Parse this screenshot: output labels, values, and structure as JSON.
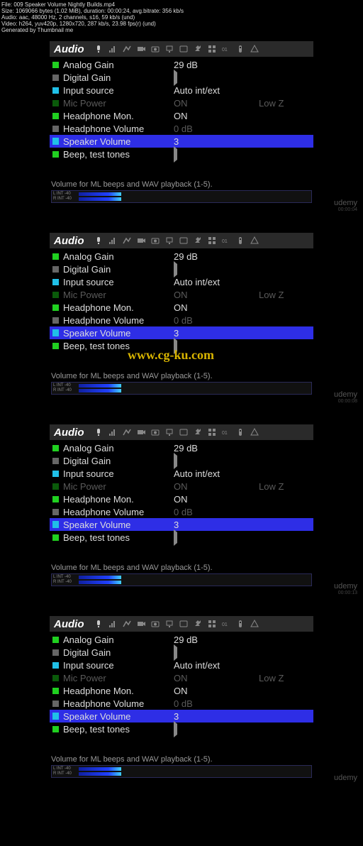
{
  "meta": {
    "line1": "File: 009 Speaker Volume Nightly Builds.mp4",
    "line2": "Size: 1069066 bytes (1.02 MiB), duration: 00:00:24, avg.bitrate: 356 kb/s",
    "line3": "Audio: aac, 48000 Hz, 2 channels, s16, 59 kb/s (und)",
    "line4": "Video: h264, yuv420p, 1280x720, 287 kb/s, 23.98 fps(r) (und)",
    "line5": "Generated by Thumbnail me"
  },
  "panel": {
    "title": "Audio",
    "items": [
      {
        "bullet": "b-green",
        "label": "Analog Gain",
        "value": "29 dB"
      },
      {
        "bullet": "b-gray",
        "label": "Digital Gain",
        "value": "",
        "tri": true
      },
      {
        "bullet": "b-cyan",
        "label": "Input source",
        "value": "Auto int/ext"
      },
      {
        "bullet": "b-darkgreen",
        "label": "Mic Power",
        "value": "ON",
        "dim": true,
        "extra": "Low Z"
      },
      {
        "bullet": "b-green",
        "label": "Headphone Mon.",
        "value": "ON"
      },
      {
        "bullet": "b-gray",
        "label": "Headphone Volume",
        "value": "0 dB",
        "vdim": true
      },
      {
        "bullet": "b-cyanbox",
        "label": "Speaker Volume",
        "value": "3",
        "sel": true
      },
      {
        "bullet": "b-green",
        "label": "Beep, test tones",
        "value": "",
        "tri": true
      }
    ],
    "hint": "Volume for ML beeps and WAV playback (1-5).",
    "meter": {
      "l1": "L INT -40",
      "l2": "R INT -40"
    }
  },
  "watermark": "www.cg-ku.com",
  "brand": "udemy",
  "timestamps": [
    "00:00:04",
    "00:00:08",
    "00:00:13",
    ""
  ]
}
